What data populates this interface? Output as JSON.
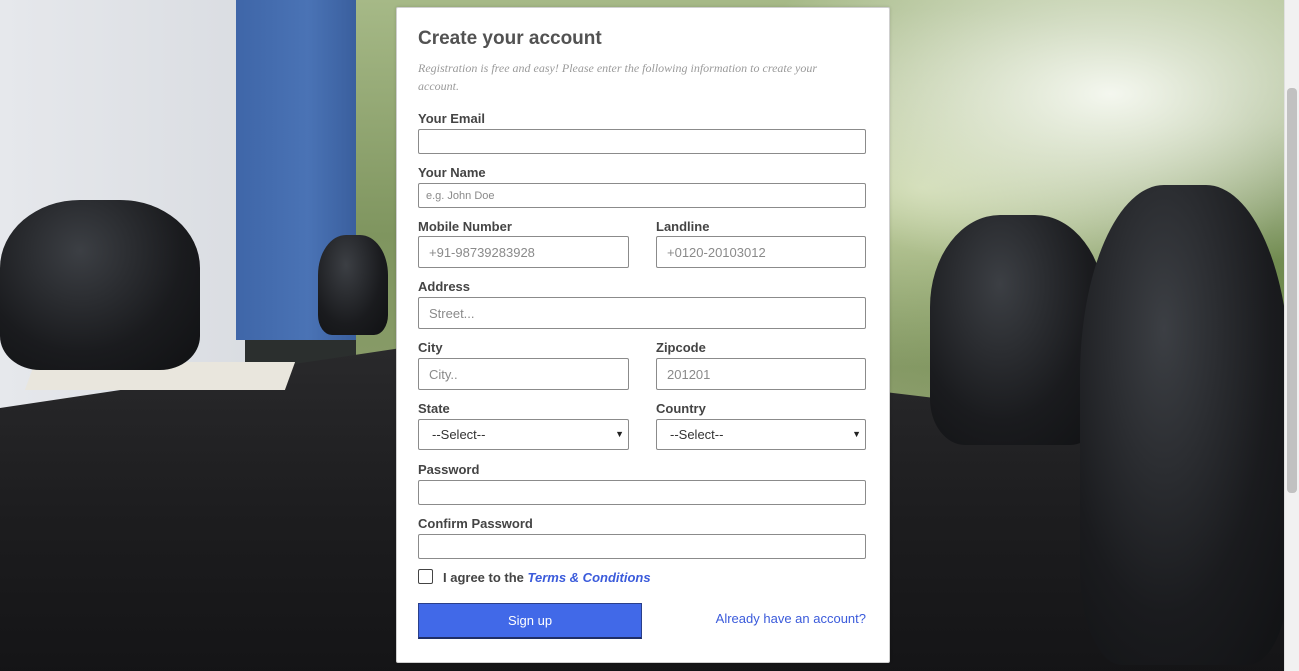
{
  "form": {
    "title": "Create your account",
    "subtitle": "Registration is free and easy! Please enter the following information to create your account.",
    "email": {
      "label": "Your Email",
      "value": "",
      "placeholder": ""
    },
    "name": {
      "label": "Your Name",
      "value": "",
      "placeholder": "e.g. John Doe"
    },
    "mobile": {
      "label": "Mobile Number",
      "value": "",
      "placeholder": "+91-98739283928"
    },
    "landline": {
      "label": "Landline",
      "value": "",
      "placeholder": "+0120-20103012"
    },
    "address": {
      "label": "Address",
      "value": "",
      "placeholder": "Street..."
    },
    "city": {
      "label": "City",
      "value": "",
      "placeholder": "City.."
    },
    "zipcode": {
      "label": "Zipcode",
      "value": "",
      "placeholder": "201201"
    },
    "state": {
      "label": "State",
      "selected": "--Select--"
    },
    "country": {
      "label": "Country",
      "selected": "--Select--"
    },
    "password": {
      "label": "Password",
      "value": ""
    },
    "confirm_password": {
      "label": "Confirm Password",
      "value": ""
    },
    "agree": {
      "prefix": "I agree to the ",
      "link": "Terms & Conditions",
      "checked": false
    },
    "signup_label": "Sign up",
    "already_label": "Already have an account?"
  },
  "colors": {
    "accent": "#4169e8",
    "link": "#3b5bdb"
  }
}
